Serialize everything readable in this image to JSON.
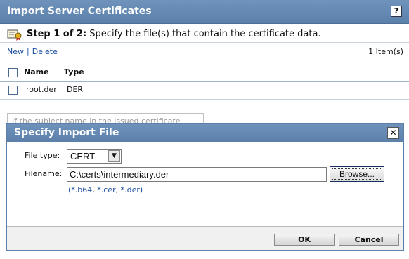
{
  "window": {
    "title": "Import Server Certificates",
    "help_glyph": "?"
  },
  "step": {
    "strong": "Step 1 of 2:",
    "text": "Specify the file(s) that contain the certificate data."
  },
  "toolbar": {
    "new_label": "New",
    "separator": "|",
    "delete_label": "Delete",
    "item_count": "1 Item(s)"
  },
  "table": {
    "columns": [
      "Name",
      "Type"
    ],
    "rows": [
      {
        "name": "root.der",
        "type": "DER"
      }
    ]
  },
  "background_hint": "If the subject name in the issued certificate",
  "dialog": {
    "title": "Specify Import File",
    "close_glyph": "✕",
    "file_type_label": "File type:",
    "file_type_value": "CERT",
    "filename_label": "Filename:",
    "filename_value": "C:\\certs\\intermediary.der",
    "browse_label": "Browse...",
    "extensions_hint": "(*.b64, *.cer, *.der)",
    "ok_label": "OK",
    "cancel_label": "Cancel"
  },
  "colors": {
    "titlebar": "#5b80aa",
    "link": "#1b4f9c"
  }
}
